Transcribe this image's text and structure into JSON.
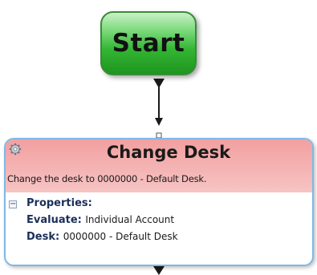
{
  "start_node": {
    "label": "Start",
    "color": "#33b533"
  },
  "activity": {
    "title": "Change Desk",
    "description": "Change the desk to 0000000 - Default Desk.",
    "header_color": "#f5b5b5",
    "border_color": "#7fb8e8",
    "collapse_glyph": "−",
    "properties": {
      "heading": "Properties:",
      "items": [
        {
          "key": "Evaluate:",
          "value": "Individual Account"
        },
        {
          "key": "Desk:",
          "value": "0000000 - Default Desk"
        }
      ]
    }
  },
  "icons": {
    "activity_icon": "gear-icon",
    "toggle_icon": "collapse-icon"
  }
}
